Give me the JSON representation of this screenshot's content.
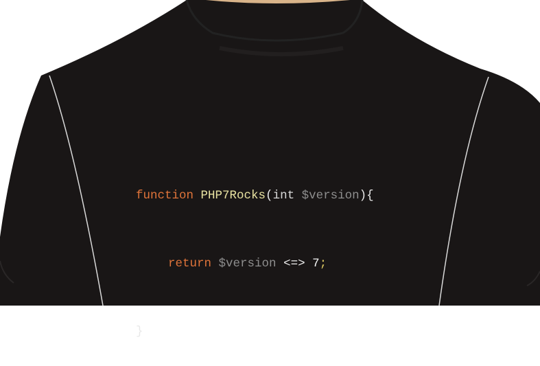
{
  "colors": {
    "background": "#ffffff",
    "shirt": "#191616",
    "seam": "#d9d9d9",
    "skin": "#d9b48a",
    "keyword": "#e0743a",
    "function_name": "#e9e3a2",
    "variable": "#8e8e8e",
    "text": "#e8e8e8",
    "semicolon": "#d9c560"
  },
  "code": {
    "line1": {
      "keyword": "function",
      "name": "PHP7Rocks",
      "open_paren": "(",
      "type": "int",
      "param": "$version",
      "close": "){"
    },
    "line2": {
      "keyword": "return",
      "var": "$version",
      "operator": "<=>",
      "number": "7",
      "semicolon": ";"
    },
    "line3": {
      "brace": "}"
    }
  }
}
